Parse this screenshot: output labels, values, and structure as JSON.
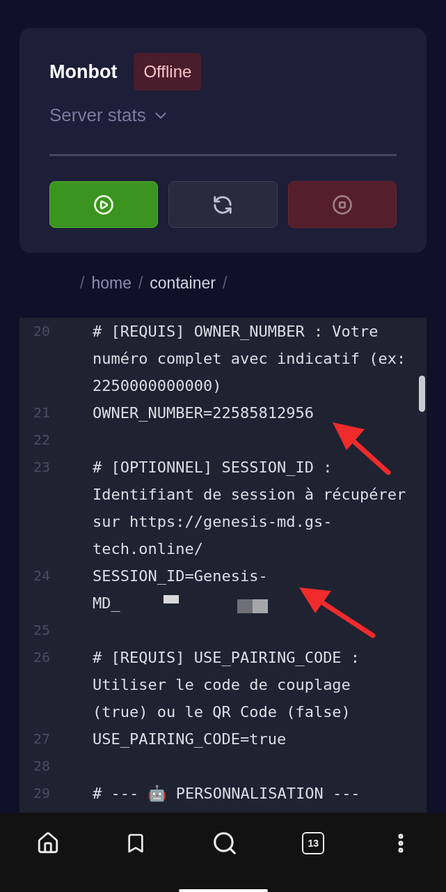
{
  "header": {
    "title": "Monbot",
    "status": {
      "label": "Offline",
      "kind": "offline"
    },
    "stats_toggle": {
      "label": "Server stats",
      "expanded": false
    }
  },
  "actions": [
    {
      "kind": "start"
    },
    {
      "kind": "restart"
    },
    {
      "kind": "stop"
    }
  ],
  "breadcrumb": [
    {
      "kind": "sep",
      "text": "/"
    },
    {
      "kind": "link",
      "text": "home"
    },
    {
      "kind": "sep",
      "text": "/"
    },
    {
      "kind": "current",
      "text": "container"
    },
    {
      "kind": "sep",
      "text": "/"
    }
  ],
  "editor": {
    "lines": [
      {
        "number": "20",
        "text": "# [REQUIS] OWNER_NUMBER : Votre numéro complet avec indicatif (ex: 2250000000000)"
      },
      {
        "number": "21",
        "text": "OWNER_NUMBER=22585812956"
      },
      {
        "number": "22"
      },
      {
        "number": "23",
        "text": "# [OPTIONNEL] SESSION_ID : Identifiant de session à récupérer sur https://genesis-md.gs-tech.online/"
      },
      {
        "number": "24",
        "text": "SESSION_ID=Genesis-MD_",
        "redacted": true
      },
      {
        "number": "25"
      },
      {
        "number": "26",
        "text": "# [REQUIS] USE_PAIRING_CODE : Utiliser le code de couplage (true) ou le QR Code (false)"
      },
      {
        "number": "27",
        "text": "USE_PAIRING_CODE=true"
      },
      {
        "number": "28"
      },
      {
        "number": "29",
        "text": "# --- 🤖 PERSONNALISATION ---"
      }
    ]
  },
  "nav": {
    "tab_count": "13"
  }
}
